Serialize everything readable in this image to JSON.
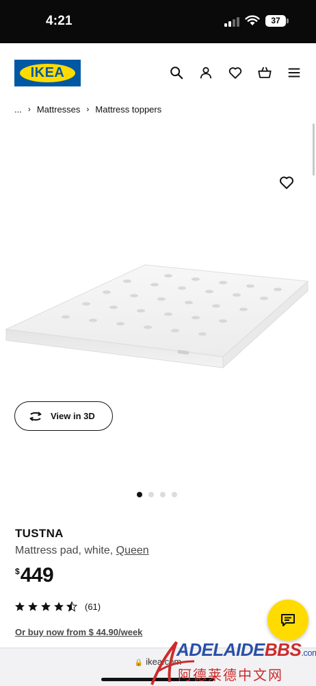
{
  "status_bar": {
    "time": "4:21",
    "battery_level": "37"
  },
  "header": {
    "logo_text": "IKEA",
    "icons": [
      "search-icon",
      "account-icon",
      "heart-icon",
      "basket-icon",
      "menu-icon"
    ]
  },
  "breadcrumb": {
    "items": [
      "...",
      "Mattresses",
      "Mattress toppers"
    ]
  },
  "gallery": {
    "view_3d_label": "View in 3D",
    "image_count": 4,
    "active_index": 0
  },
  "product": {
    "name": "TUSTNA",
    "description": "Mattress pad, white,",
    "size_label": "Queen",
    "currency_symbol": "$",
    "price": "449",
    "rating_value": 4.5,
    "rating_count": "(61)",
    "finance_text": "Or buy now from $ 44.90/week"
  },
  "browser": {
    "url": "ikea.com"
  },
  "watermark": {
    "top_blue": "ADELAIDE",
    "top_red": "BBS",
    "top_suffix": ".com",
    "bottom": "阿德莱德中文网"
  },
  "colors": {
    "ikea_blue": "#0058a3",
    "ikea_yellow": "#ffdb00",
    "text_dark": "#111111",
    "text_muted": "#484848"
  }
}
